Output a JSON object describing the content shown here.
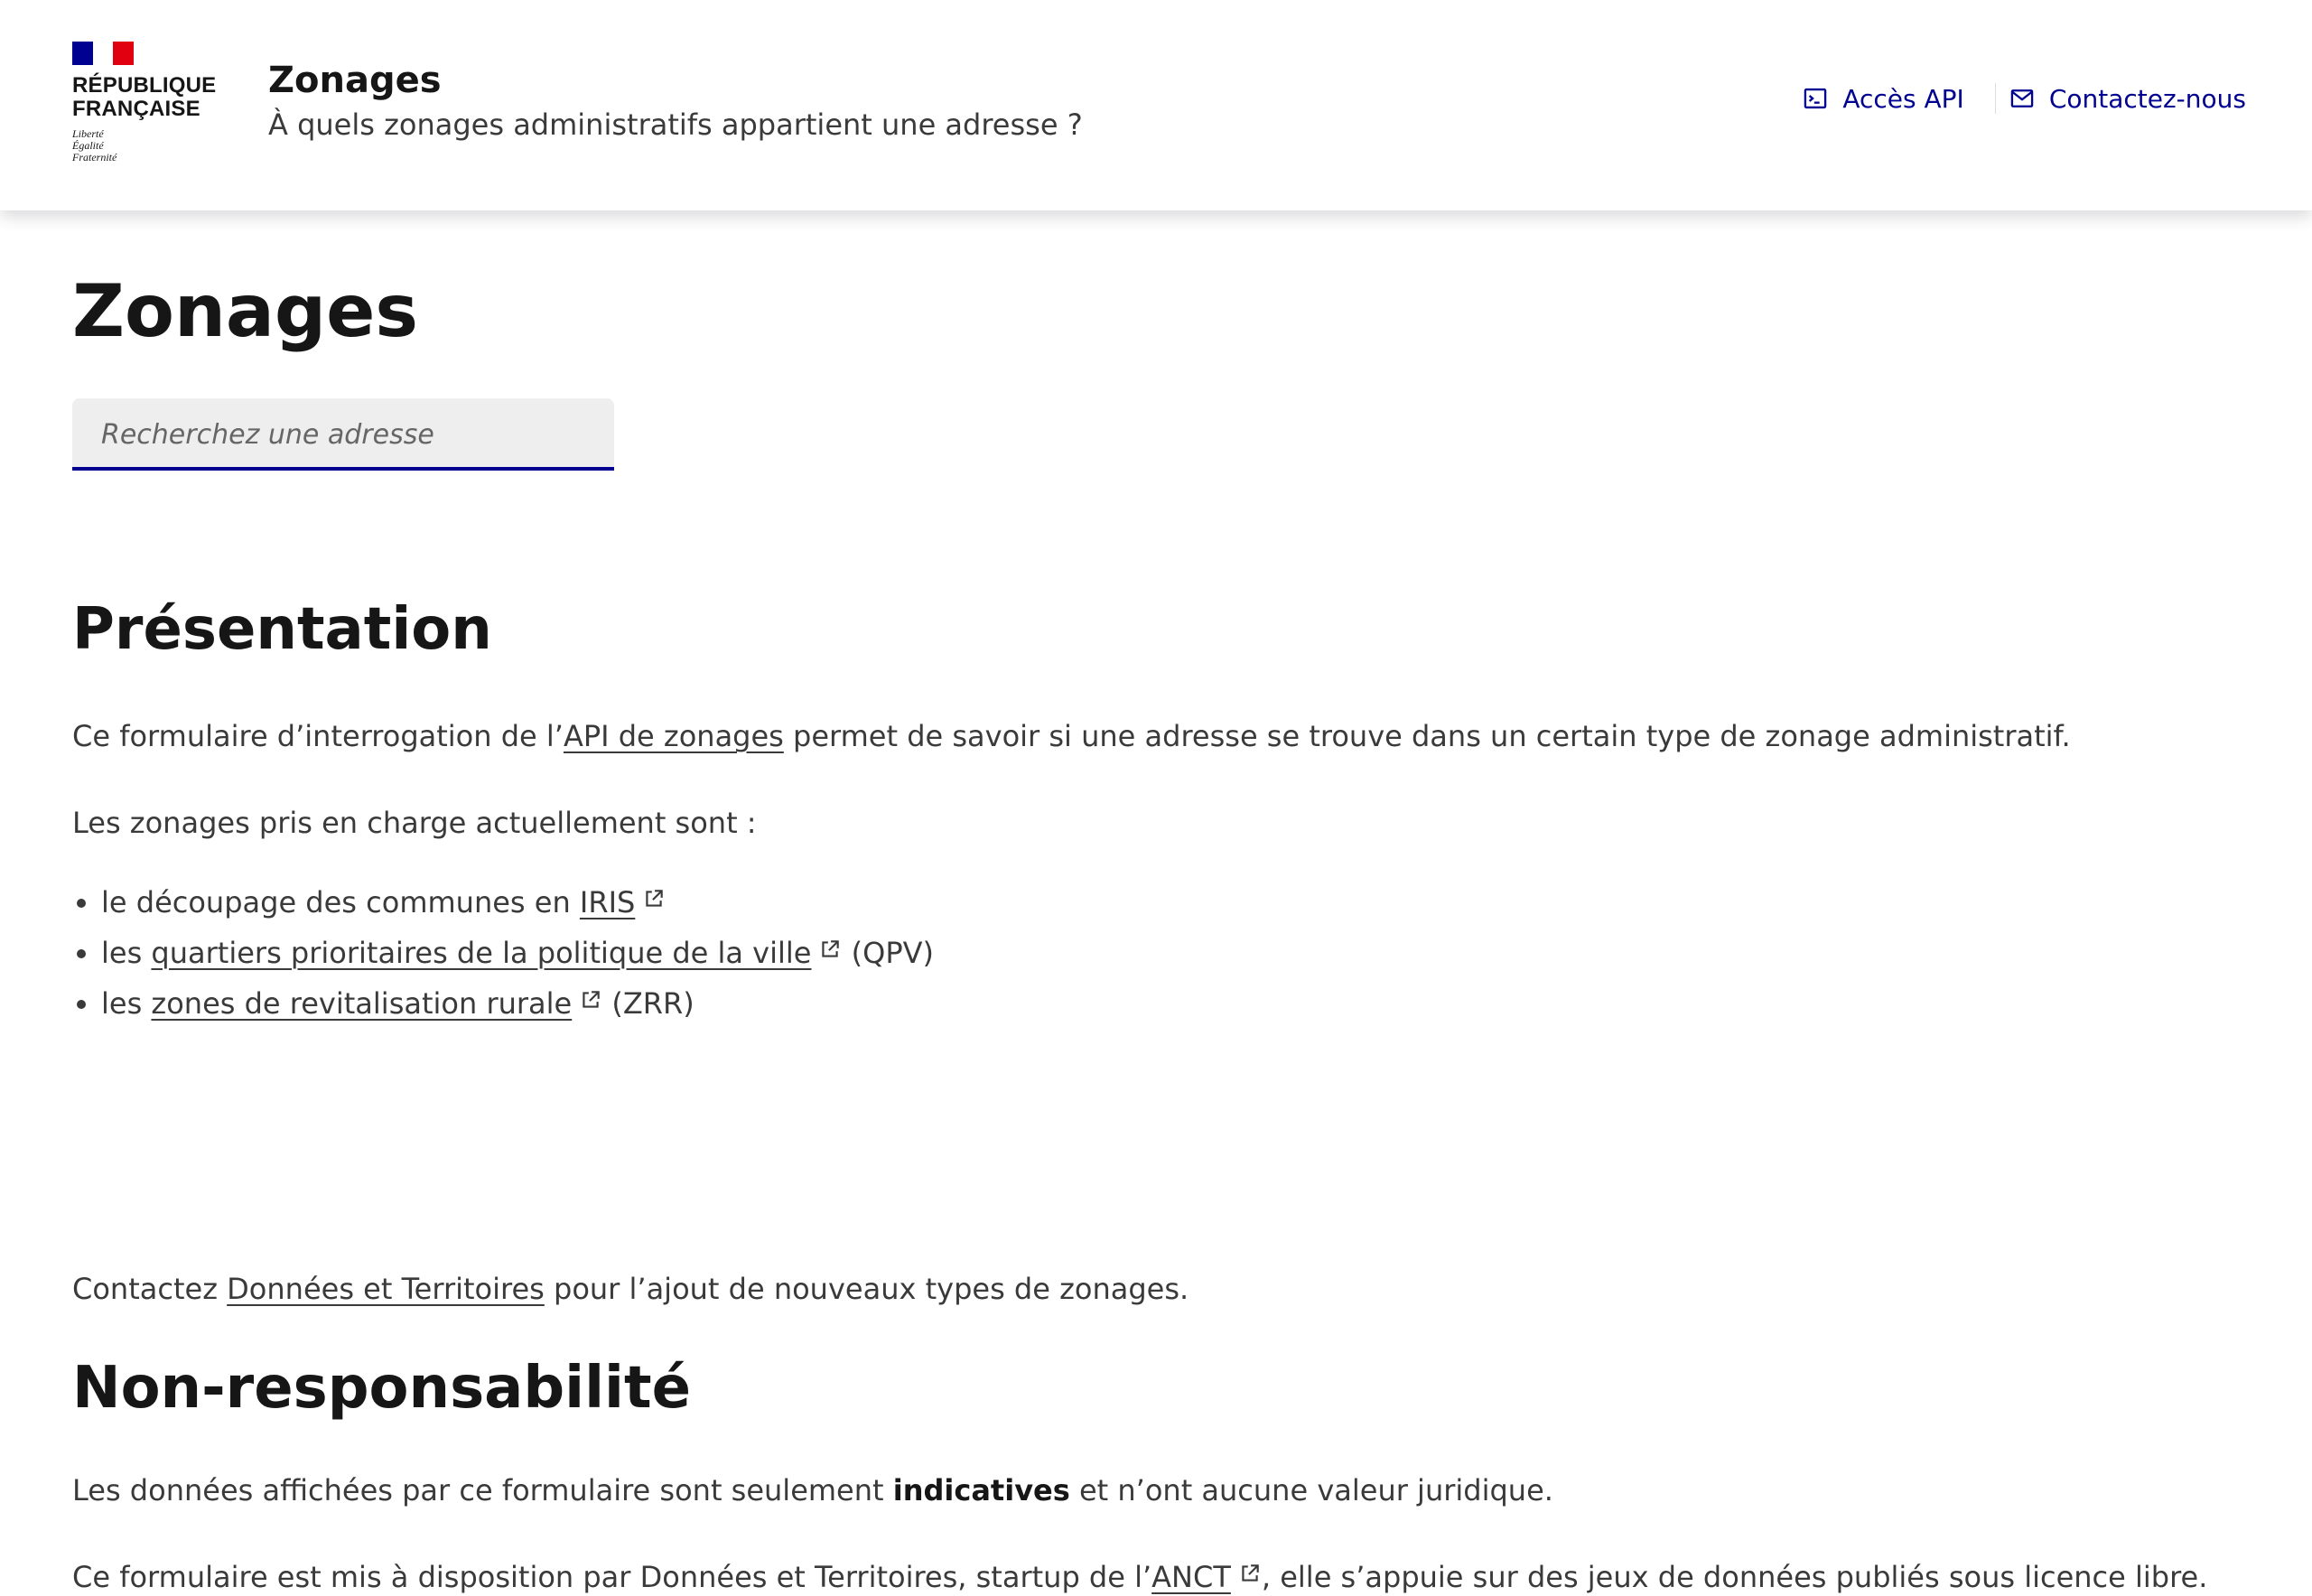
{
  "header": {
    "logo_line1": "RÉPUBLIQUE",
    "logo_line2": "FRANÇAISE",
    "motto": [
      "Liberté",
      "Égalité",
      "Fraternité"
    ],
    "service_title": "Zonages",
    "service_tagline": "À quels zonages administratifs appartient une adresse ?",
    "links": [
      {
        "label": "Accès API",
        "icon": "terminal-icon"
      },
      {
        "label": "Contactez-nous",
        "icon": "mail-icon"
      }
    ]
  },
  "main": {
    "title": "Zonages",
    "search": {
      "placeholder": "Recherchez une adresse"
    },
    "presentation": {
      "heading": "Présentation",
      "intro_before": "Ce formulaire d’interrogation de l’",
      "intro_link": "API de zonages",
      "intro_after": " permet de savoir si une adresse se trouve dans un certain type de zonage administratif.",
      "list_intro": "Les zonages pris en charge actuellement sont :",
      "items": [
        {
          "before": "le découpage des communes en ",
          "link": "IRIS",
          "after": ""
        },
        {
          "before": "les ",
          "link": "quartiers prioritaires de la politique de la ville",
          "after": " (QPV)"
        },
        {
          "before": "les ",
          "link": "zones de revitalisation rurale",
          "after": " (ZRR)"
        }
      ],
      "contact_before": "Contactez ",
      "contact_link": "Données et Territoires",
      "contact_after": " pour l’ajout de nouveaux types de zonages."
    },
    "disclaimer": {
      "heading": "Non-responsabilité",
      "p1_before": "Les données affichées par ce formulaire sont seulement ",
      "p1_bold": "indicatives",
      "p1_after": " et n’ont aucune valeur juridique.",
      "p2_before": "Ce formulaire est mis à disposition par Données et Territoires, startup de l’",
      "p2_link": "ANCT",
      "p2_after": ", elle s’appuie sur des jeux de données publiés sous licence libre."
    }
  },
  "colors": {
    "accent": "#000091",
    "title": "#161616",
    "text": "#3a3a3a",
    "input_bg": "#eeeeee",
    "flag_red": "#e1000f"
  }
}
